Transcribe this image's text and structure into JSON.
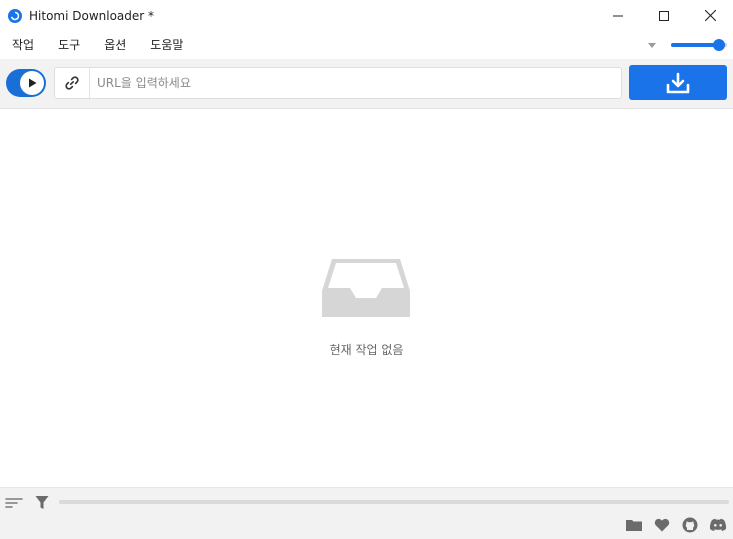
{
  "window": {
    "title": "Hitomi Downloader *"
  },
  "menu": [
    {
      "label": "작업"
    },
    {
      "label": "도구"
    },
    {
      "label": "옵션"
    },
    {
      "label": "도움말"
    }
  ],
  "volume": {
    "level": 0.86
  },
  "toolbar": {
    "url_placeholder": "URL을 입력하세요",
    "url_value": ""
  },
  "empty_state": {
    "message": "현재 작업 없음"
  },
  "progress": {
    "fraction": 0
  },
  "colors": {
    "accent": "#1a73e8",
    "icon_gray": "#6b6b6b",
    "tray_gray": "#d6d6d6"
  },
  "icons": {
    "app": "hitomi-app-icon",
    "minimize": "minimize-icon",
    "maximize": "maximize-icon",
    "close": "close-icon",
    "dropdown": "caret-down-icon",
    "link": "link-icon",
    "download": "download-icon",
    "tray": "inbox-tray-icon",
    "sort": "sort-icon",
    "filter": "filter-icon",
    "folder": "folder-icon",
    "heart": "heart-icon",
    "github": "github-icon",
    "discord": "discord-icon"
  }
}
